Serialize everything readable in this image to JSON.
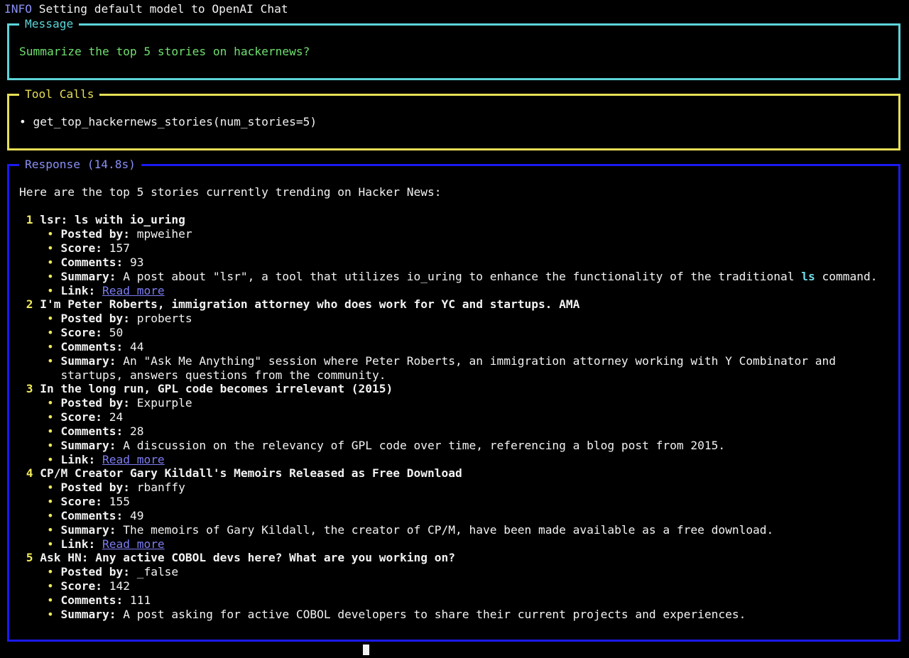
{
  "log": {
    "level": "INFO",
    "text": "Setting default model to OpenAI Chat"
  },
  "message": {
    "title": "Message",
    "text": "Summarize the top 5 stories on hackernews?"
  },
  "tool_calls": {
    "title": "Tool Calls",
    "bullet": "•",
    "items": [
      "get_top_hackernews_stories(num_stories=5)"
    ]
  },
  "response": {
    "title": "Response (14.8s)",
    "intro": "Here are the top 5 stories currently trending on Hacker News:",
    "labels": {
      "posted_by": "Posted by:",
      "score": "Score:",
      "comments": "Comments:",
      "summary": "Summary:",
      "link": "Link:"
    },
    "stories": [
      {
        "num": "1",
        "title": "lsr: ls with io_uring",
        "posted_by": "mpweiher",
        "score": "157",
        "comments": "93",
        "summary_pre": "A post about \"lsr\", a tool that utilizes io_uring to enhance the functionality of the traditional",
        "summary_code": "ls",
        "summary_post": "command.",
        "link_text": "Read more"
      },
      {
        "num": "2",
        "title": "I'm Peter Roberts, immigration attorney who does work for YC and startups. AMA",
        "posted_by": "proberts",
        "score": "50",
        "comments": "44",
        "summary_line1": "An \"Ask Me Anything\" session where Peter Roberts, an immigration attorney working with Y Combinator and",
        "summary_line2": "startups, answers questions from the community."
      },
      {
        "num": "3",
        "title": "In the long run, GPL code becomes irrelevant (2015)",
        "posted_by": "Expurple",
        "score": "24",
        "comments": "28",
        "summary": "A discussion on the relevancy of GPL code over time, referencing a blog post from 2015.",
        "link_text": "Read more"
      },
      {
        "num": "4",
        "title": "CP/M Creator Gary Kildall's Memoirs Released as Free Download",
        "posted_by": "rbanffy",
        "score": "155",
        "comments": "49",
        "summary": "The memoirs of Gary Kildall, the creator of CP/M, have been made available as a free download.",
        "link_text": "Read more"
      },
      {
        "num": "5",
        "title": "Ask HN: Any active COBOL devs here? What are you working on?",
        "posted_by": "_false",
        "score": "142",
        "comments": "111",
        "summary": "A post asking for active COBOL developers to share their current projects and experiences."
      }
    ]
  },
  "colors": {
    "message_border": "#5cd4d8",
    "tool_calls_border": "#e6de55",
    "response_border": "#1a1af0",
    "user_text": "#6fe06f",
    "link": "#7d7df3",
    "background": "#000000"
  }
}
